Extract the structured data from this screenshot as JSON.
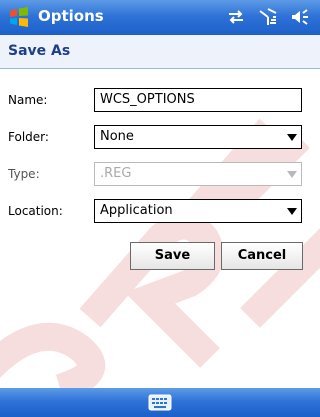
{
  "titlebar": {
    "title": "Options",
    "icons": [
      "windows-logo-icon",
      "connectivity-icon",
      "signal-icon",
      "volume-icon"
    ]
  },
  "header": {
    "title": "Save As"
  },
  "form": {
    "name_label": "Name:",
    "name_value": "WCS_OPTIONS",
    "folder_label": "Folder:",
    "folder_value": "None",
    "type_label": "Type:",
    "type_value": ".REG",
    "location_label": "Location:",
    "location_value": "Application"
  },
  "buttons": {
    "save": "Save",
    "cancel": "Cancel"
  },
  "bottombar": {
    "icon": "keyboard-icon"
  },
  "colors": {
    "bar_blue": "#2f73d8",
    "header_text": "#1d3f8a",
    "watermark": "#e8a0a0"
  }
}
